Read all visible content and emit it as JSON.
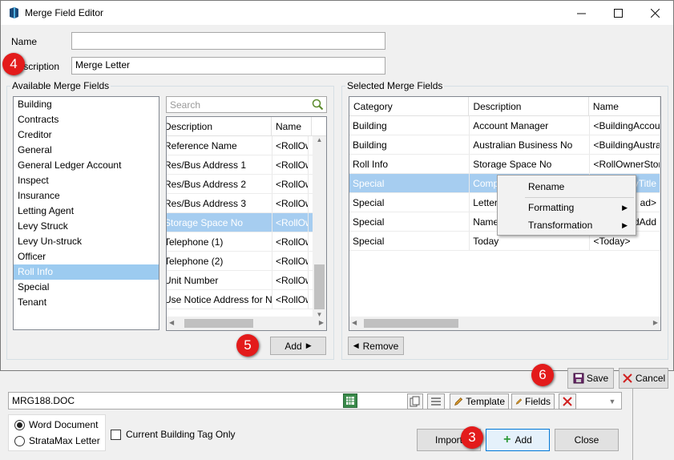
{
  "dialog": {
    "title": "Merge Field Editor",
    "name_label": "Name",
    "name_value": "",
    "description_label": "Description",
    "description_value": "Merge Letter"
  },
  "available": {
    "group_label": "Available Merge Fields",
    "categories": [
      "Building",
      "Contracts",
      "Creditor",
      "General",
      "General Ledger Account",
      "Inspect",
      "Insurance",
      "Letting Agent",
      "Levy Struck",
      "Levy Un-struck",
      "Officer",
      "Roll Info",
      "Special",
      "Tenant"
    ],
    "selected_category": "Roll Info",
    "search_placeholder": "Search",
    "columns": [
      "Description",
      "Name"
    ],
    "fields": [
      {
        "description": "Reference Name",
        "name": "<RollOw"
      },
      {
        "description": "Res/Bus Address 1",
        "name": "<RollOw"
      },
      {
        "description": "Res/Bus Address 2",
        "name": "<RollOw"
      },
      {
        "description": "Res/Bus Address 3",
        "name": "<RollOw"
      },
      {
        "description": "Storage Space No",
        "name": "<RollOw"
      },
      {
        "description": "Telephone (1)",
        "name": "<RollOw"
      },
      {
        "description": "Telephone (2)",
        "name": "<RollOw"
      },
      {
        "description": "Unit Number",
        "name": "<RollOw"
      },
      {
        "description": "Use Notice Address for Not",
        "name": "<RollOw"
      }
    ],
    "add_label": "Add"
  },
  "selected": {
    "group_label": "Selected Merge Fields",
    "columns": [
      "Category",
      "Description",
      "Name"
    ],
    "rows": [
      {
        "category": "Building",
        "description": "Account Manager",
        "name": "<BuildingAccou"
      },
      {
        "category": "Building",
        "description": "Australian Business No",
        "name": "<BuildingAustra"
      },
      {
        "category": "Roll Info",
        "description": "Storage Space No",
        "name": "<RollOwnerStor"
      },
      {
        "category": "Special",
        "description": "Comp",
        "name": "yTitle"
      },
      {
        "category": "Special",
        "description": "Letter",
        "name": "ad>"
      },
      {
        "category": "Special",
        "description": "Name",
        "name": "dAdd"
      },
      {
        "category": "Special",
        "description": "Today",
        "name": "<Today>"
      }
    ],
    "remove_label": "Remove"
  },
  "context_menu": {
    "items": [
      "Rename",
      "Formatting",
      "Transformation"
    ]
  },
  "footer": {
    "save_label": "Save",
    "cancel_label": "Cancel"
  },
  "background_window": {
    "doc_name": "MRG188.DOC",
    "template_label": "Template",
    "fields_label": "Fields",
    "word_document_label": "Word Document",
    "stratamax_letter_label": "StrataMax Letter",
    "current_building_label": "Current Building Tag Only",
    "import_label": "Import",
    "add_label": "Add",
    "close_label": "Close"
  },
  "badges": [
    "4",
    "5",
    "6",
    "3"
  ],
  "colors": {
    "selection": "#9ccbf0",
    "badge": "#e31b1b",
    "accent": "#0078d7"
  }
}
